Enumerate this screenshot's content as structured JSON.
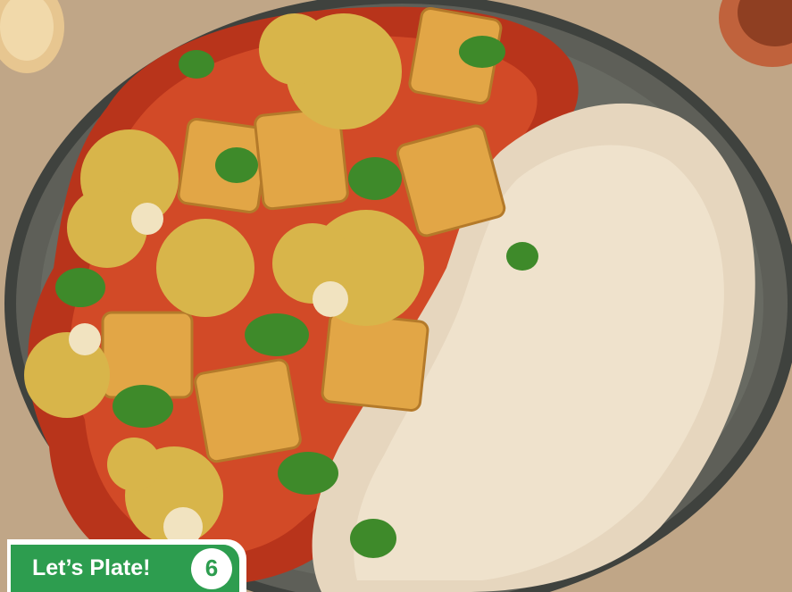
{
  "step": {
    "title": "Let’s Plate!",
    "number": "6",
    "badge_color": "#2d9d4f"
  },
  "photo": {
    "subject": "plate-of-curry-with-rice",
    "colors": {
      "plate": "#5e5f58",
      "sauce": "#c83a1f",
      "rice": "#e6d6be",
      "garnish": "#3e8a2a"
    }
  }
}
